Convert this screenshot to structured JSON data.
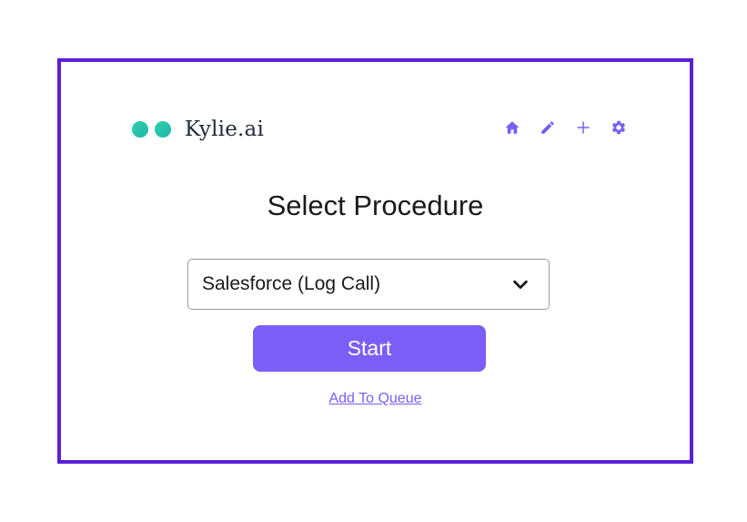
{
  "app": {
    "name": "Kylie.ai",
    "accent_color": "#7b5ef5",
    "frame_color": "#5a1fd6",
    "logo_color": "#2ec4ad"
  },
  "header": {
    "nav_icons": [
      "home-icon",
      "pencil-icon",
      "plus-icon",
      "gear-icon"
    ]
  },
  "main": {
    "title": "Select Procedure",
    "procedure_select": {
      "selected": "Salesforce (Log Call)"
    },
    "start_label": "Start",
    "queue_link_label": "Add To Queue"
  }
}
